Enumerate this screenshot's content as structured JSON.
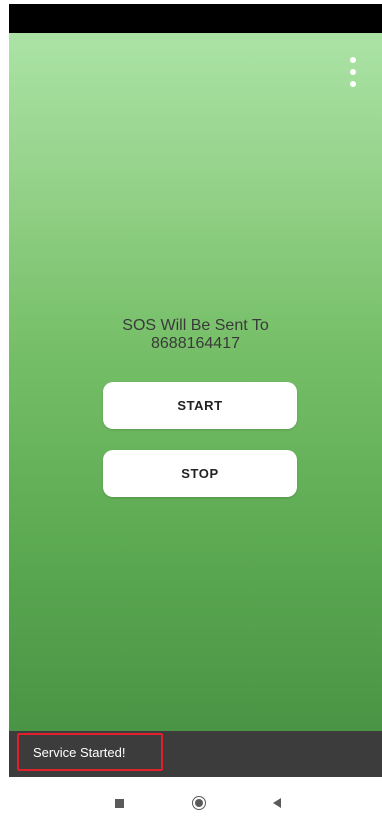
{
  "main": {
    "sos_line1": "SOS Will Be Sent To",
    "sos_line2": "8688164417"
  },
  "buttons": {
    "start_label": "START",
    "stop_label": "STOP"
  },
  "snackbar": {
    "message": "Service Started!"
  },
  "icons": {
    "overflow_menu": "more-vert-icon",
    "recents": "recents-square-icon",
    "home": "home-circle-icon",
    "back": "back-triangle-icon"
  },
  "colors": {
    "gradient_top": "#abe3a5",
    "gradient_bottom": "#4a9445",
    "snackbar_bg": "#3c3c3c",
    "highlight_border": "#e0202a"
  }
}
